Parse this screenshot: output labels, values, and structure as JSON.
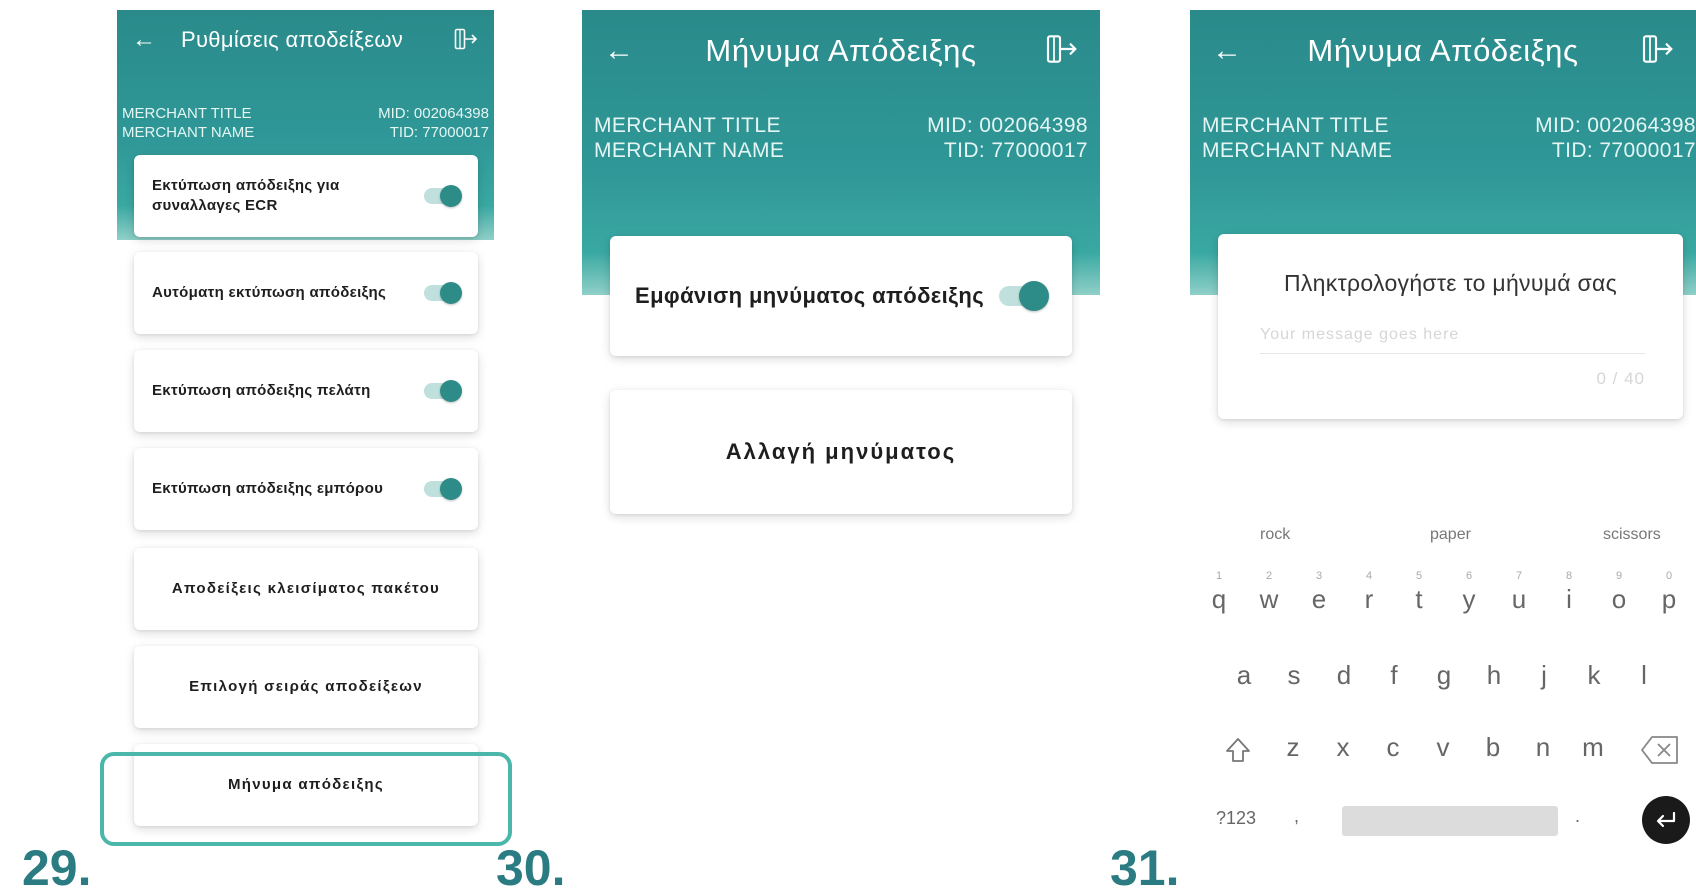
{
  "colors": {
    "teal_dark": "#2a8a8a",
    "teal_accent": "#2e8c88",
    "step_color": "#2b7b82",
    "highlight": "#4bb6aa"
  },
  "screen29": {
    "step": "29.",
    "title": "Ρυθμίσεις αποδείξεων",
    "merchant_title": "MERCHANT TITLE",
    "merchant_name": "MERCHANT NAME",
    "mid": "MID: 002064398",
    "tid": "TID: 77000017",
    "items": [
      {
        "label": "Εκτύπωση απόδειξης για συναλλαγες ECR",
        "toggle": true,
        "on": true
      },
      {
        "label": "Αυτόματη εκτύπωση απόδειξης",
        "toggle": true,
        "on": true
      },
      {
        "label": "Εκτύπωση απόδειξης πελάτη",
        "toggle": true,
        "on": true
      },
      {
        "label": "Εκτύπωση απόδειξης εμπόρου",
        "toggle": true,
        "on": true
      },
      {
        "label": "Αποδείξεις κλεισίματος πακέτου",
        "toggle": false
      },
      {
        "label": "Επιλογή σειράς αποδείξεων",
        "toggle": false
      },
      {
        "label": "Μήνυμα απόδειξης",
        "toggle": false,
        "highlighted": true
      }
    ]
  },
  "screen30": {
    "step": "30.",
    "title": "Μήνυμα Απόδειξης",
    "merchant_title": "MERCHANT TITLE",
    "merchant_name": "MERCHANT NAME",
    "mid": "MID: 002064398",
    "tid": "TID: 77000017",
    "toggle_label": "Εμφάνιση μηνύματος απόδειξης",
    "toggle_on": true,
    "change_label": "Αλλαγή μηνύματος"
  },
  "screen31": {
    "step": "31.",
    "title": "Μήνυμα Απόδειξης",
    "merchant_title": "MERCHANT TITLE",
    "merchant_name": "MERCHANT NAME",
    "mid": "MID: 002064398",
    "tid": "TID: 77000017",
    "prompt": "Πληκτρολογήστε το μήνυμά σας",
    "placeholder": "Your message goes here",
    "counter": "0 / 40",
    "suggestions": [
      "rock",
      "paper",
      "scissors"
    ],
    "row1": [
      "q",
      "w",
      "e",
      "r",
      "t",
      "y",
      "u",
      "i",
      "o",
      "p"
    ],
    "row1_nums": [
      "1",
      "2",
      "3",
      "4",
      "5",
      "6",
      "7",
      "8",
      "9",
      "0"
    ],
    "row2": [
      "a",
      "s",
      "d",
      "f",
      "g",
      "h",
      "j",
      "k",
      "l"
    ],
    "row3": [
      "z",
      "x",
      "c",
      "v",
      "b",
      "n",
      "m"
    ],
    "symbols_key": "?123",
    "comma_key": ",",
    "period_key": "."
  }
}
